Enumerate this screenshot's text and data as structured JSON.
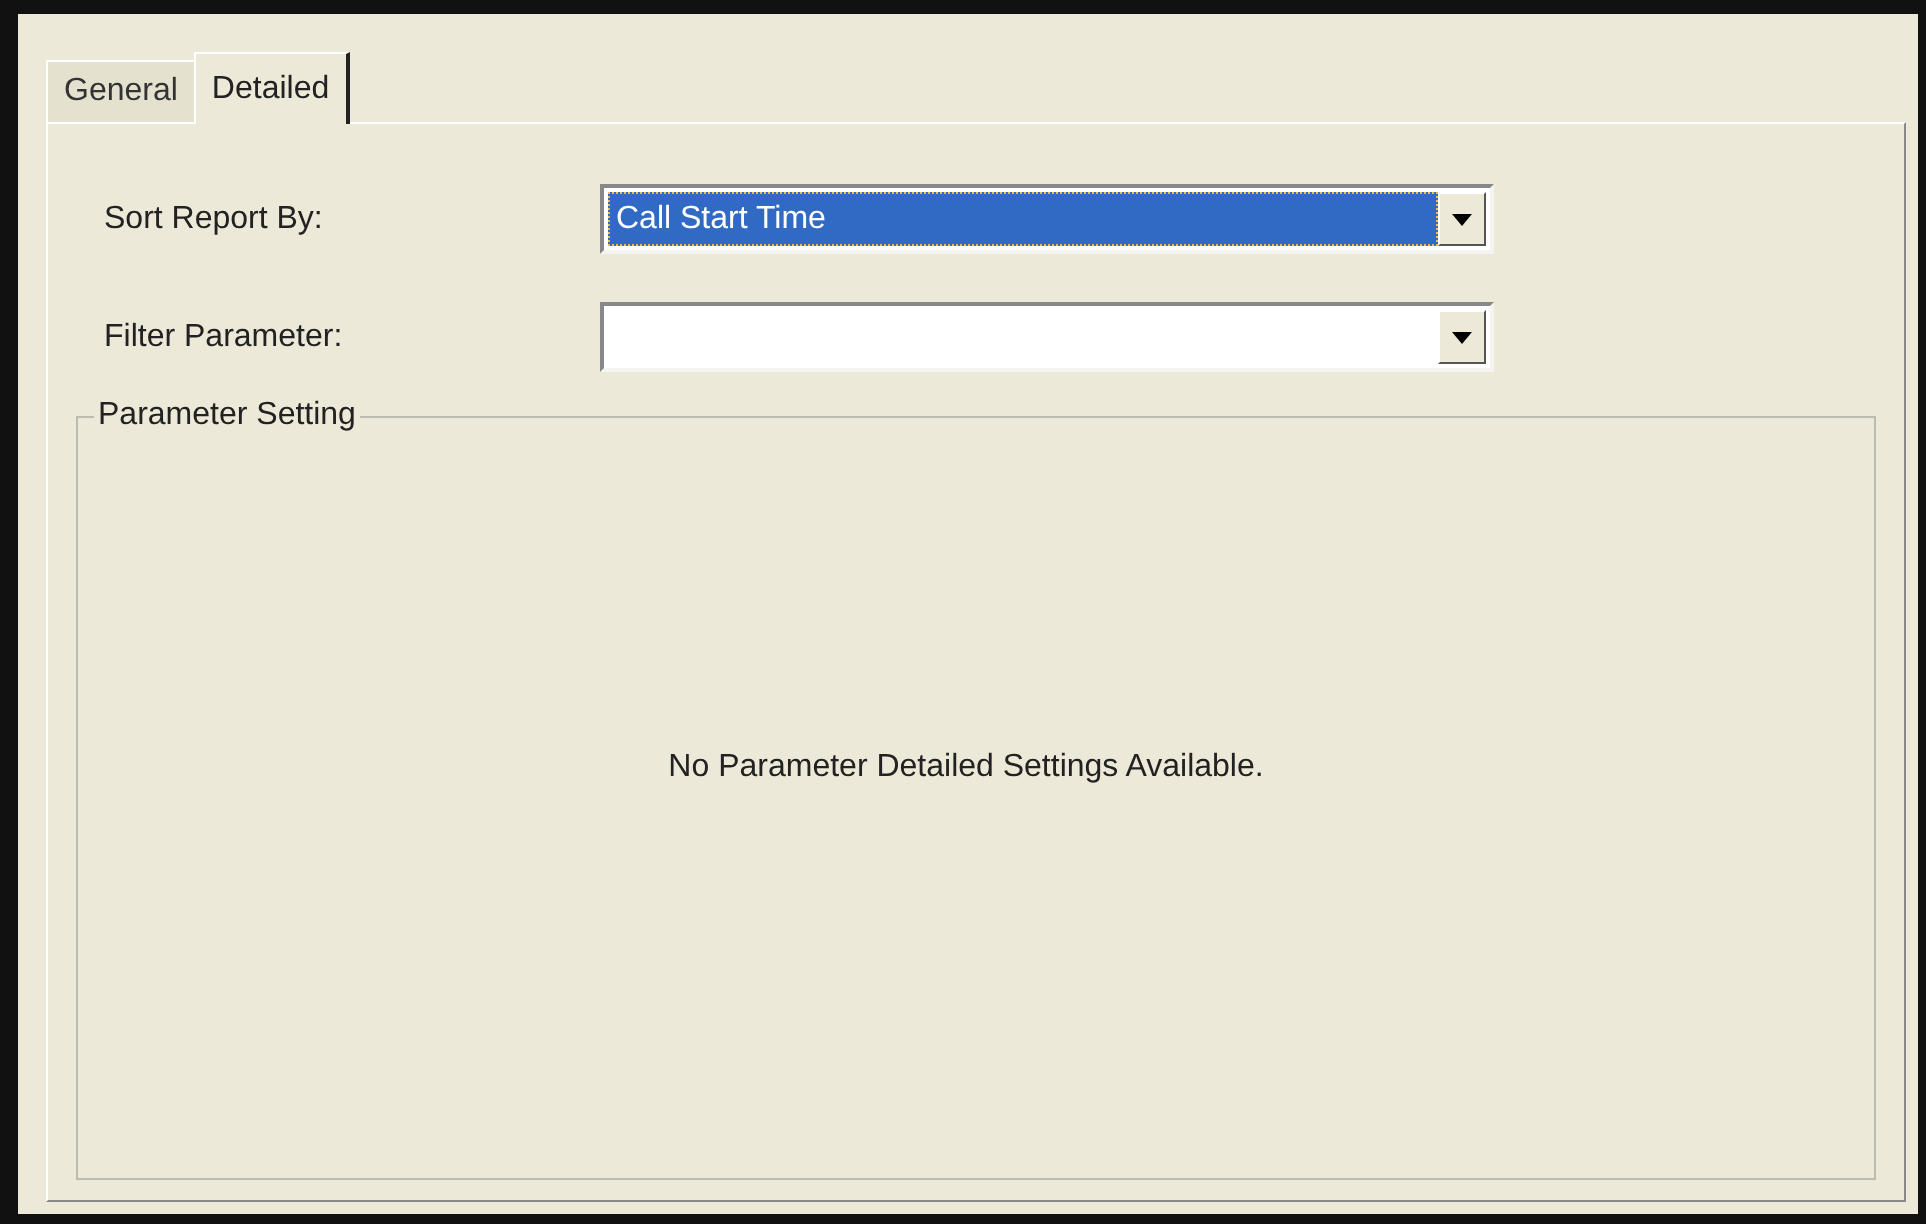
{
  "tabs": [
    {
      "label": "General",
      "selected": false
    },
    {
      "label": "Detailed",
      "selected": true
    }
  ],
  "fields": [
    {
      "label": "Sort Report By:",
      "value": "Call Start Time",
      "focused": true
    },
    {
      "label": "Filter Parameter:",
      "focused": false
    }
  ],
  "group": {
    "legend": "Parameter Setting",
    "message": "No Parameter Detailed Settings Available."
  }
}
